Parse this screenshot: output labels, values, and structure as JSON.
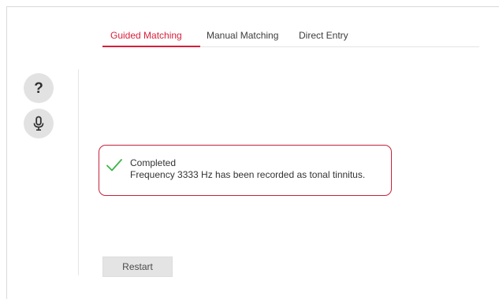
{
  "tabs": [
    {
      "label": "Guided Matching",
      "active": true
    },
    {
      "label": "Manual Matching",
      "active": false
    },
    {
      "label": "Direct Entry",
      "active": false
    }
  ],
  "side_buttons": {
    "help_label": "?",
    "help_icon": "question-mark-icon",
    "mic_icon": "microphone-icon"
  },
  "status": {
    "icon": "checkmark-icon",
    "title": "Completed",
    "message": "Frequency 3333 Hz has been recorded as tonal tinnitus."
  },
  "restart_label": "Restart",
  "colors": {
    "accent": "#d61f3c",
    "check": "#3db54a",
    "button_bg": "#e2e2e2"
  }
}
